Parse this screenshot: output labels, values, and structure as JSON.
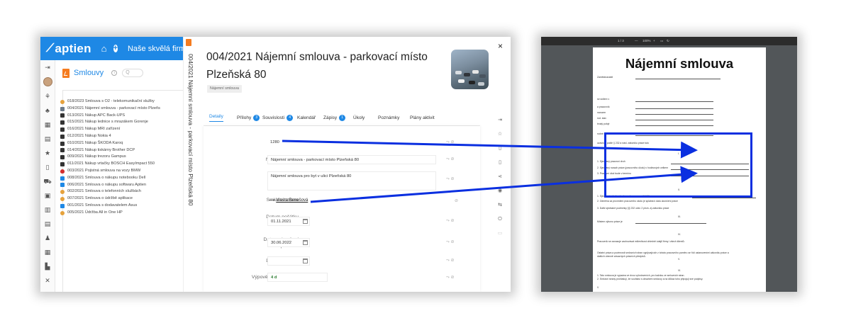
{
  "app": {
    "brand": "aptien",
    "company": "Naše skvělá firma",
    "module_title": "Smlouvy",
    "search_placeholder": "Q"
  },
  "list_items": [
    {
      "icon": "handshake",
      "text": "018/2023 Smlouva s O2 - telekomunikační služby"
    },
    {
      "icon": "doc",
      "text": "004/2021 Nájemní smlouva - parkovací místo Plzeňs"
    },
    {
      "icon": "cart",
      "text": "013/2021 Nákup APC Back-UPS"
    },
    {
      "icon": "cart",
      "text": "015/2021 Nákup lednice s mrazákem Gorenje"
    },
    {
      "icon": "cart",
      "text": "016/2021 Nákup MRI zařízení"
    },
    {
      "icon": "cart",
      "text": "012/2021 Nákup Nokia 4"
    },
    {
      "icon": "cart",
      "text": "010/2021 Nákup ŠKODA Karoq"
    },
    {
      "icon": "cart",
      "text": "014/2021 Nákup tiskárny Brother DCP"
    },
    {
      "icon": "cart",
      "text": "009/2021 Nákup trezoru Gampus"
    },
    {
      "icon": "cart",
      "text": "011/2021 Nákup vrtačky BOSCH EasyImpact 550"
    },
    {
      "icon": "shield",
      "text": "003/2021 Pojistná smlouva na vozy BMW"
    },
    {
      "icon": "case",
      "text": "008/2021 Smlouva o nákupu notebooku Dell"
    },
    {
      "icon": "case",
      "text": "006/2021 Smlouva o nákupu softwaru Aptien"
    },
    {
      "icon": "handshake",
      "text": "002/2021 Smlouva o telefonních službách"
    },
    {
      "icon": "handshake",
      "text": "007/2021 Smlouva o údržbě aplikace"
    },
    {
      "icon": "case",
      "text": "001/2021 Smlouva s dodavatelem Asus"
    },
    {
      "icon": "handshake",
      "text": "005/2021 Údržba All in One HP"
    }
  ],
  "detail": {
    "vertical_title": "004/2021 Nájemní smlouva - parkovací místo Plzeňská 80",
    "title": "004/2021 Nájemní smlouva - parkovací místo Plzeňská 80",
    "tag": "Nájemní smlouva",
    "tabs": [
      {
        "label": "Detaily",
        "badge": "",
        "active": true
      },
      {
        "label": "Přílohy",
        "badge": "3",
        "active": false
      },
      {
        "label": "Souvislosti",
        "badge": "4",
        "active": false
      },
      {
        "label": "Kalendář",
        "badge": "",
        "active": false
      },
      {
        "label": "Zápisy",
        "badge": "1",
        "active": false
      },
      {
        "label": "Úkoly",
        "badge": "",
        "active": false
      },
      {
        "label": "Poznámky",
        "badge": "",
        "active": false
      },
      {
        "label": "Plány aktivit",
        "badge": "",
        "active": false
      }
    ],
    "fields": {
      "cislo_label": "Číslo smlouvy",
      "cislo_value": "1280",
      "nazev_label": "Název smlouvy",
      "nazev_value": "Nájemní smlouva - parkovací místo Plzeňská 80",
      "popis_label": "Popis",
      "popis_value": "Nájemní smlouva pro byt v ulici Plzeňská 80",
      "strana_label": "Smluvní strana",
      "strana_value": "Vlasta Benešová",
      "pocatek_label1": "Datum počátku",
      "pocatek_label2": "platnosti",
      "pocatek_value": "01.11.2021",
      "ukonceni_label1": "Datum ukončení",
      "ukonceni_label2": "platnosti",
      "ukonceni_value": "30.06.2022",
      "podpis_label": "Datum podpisu",
      "podpis_value": "",
      "lhuta_label": "Výpovědní lhůta (dny)",
      "lhuta_value": "4 d"
    },
    "close_glyph": "×"
  },
  "pdf": {
    "toolbar_page": "1 / 3",
    "toolbar_zoom": "100%",
    "title": "Nájemní smlouva",
    "lines": [
      "Zaměstnavatel",
      "se sídlem v",
      "a pracovník",
      "narozen",
      "rod. stav",
      "trvalý pobyt",
      "rodné číslo",
      "uzavírají podle § 232 a násl. zákoníku práce tuto",
      "I.",
      "1. Sjednaný pracovní druh",
      "2. Sjednaný rozsah práce (pracovního úkolu) v hodinových celkem",
      "3. Pracovní úkol bude v termínu",
      "II.",
      "1. Sjednaná odměna                  bude vyplacena ve výši lhůty",
      "2. Odměna za provedení pracovního úkolu je splatná k datu ukončení práce",
      "3. Další sjednané podmínky §§ 232 odst. 2 písm. a) zákoníku práce",
      "III.",
      "Místem výkonu práce je",
      "IV.",
      "Pracovník se zavazuje zachovávat mlčenlivost ohledně údajů firmy i všech klientů.",
      "V.",
      "Ostatní práva a povinnosti smluvních stran vyplývajících z tohoto pracovního poměru se řídí ustanoveními zákoníku práce a",
      "dalších obecně závazných právních předpisů.",
      "VI.",
      "1. Tato smlouva je vypsána ve dvou vyhotoveních, pro každou ze smluvních stran.",
      "2. Smluvní strany prohlašují, že souhlasí s obsahem smlouvy a na důkaz toho připojují své podpisy.",
      "V"
    ]
  },
  "colors": {
    "accent": "#1e88e5",
    "highlight": "#0a2fe0",
    "badge": "#1e88e5",
    "brand_orange": "#f57c20"
  }
}
